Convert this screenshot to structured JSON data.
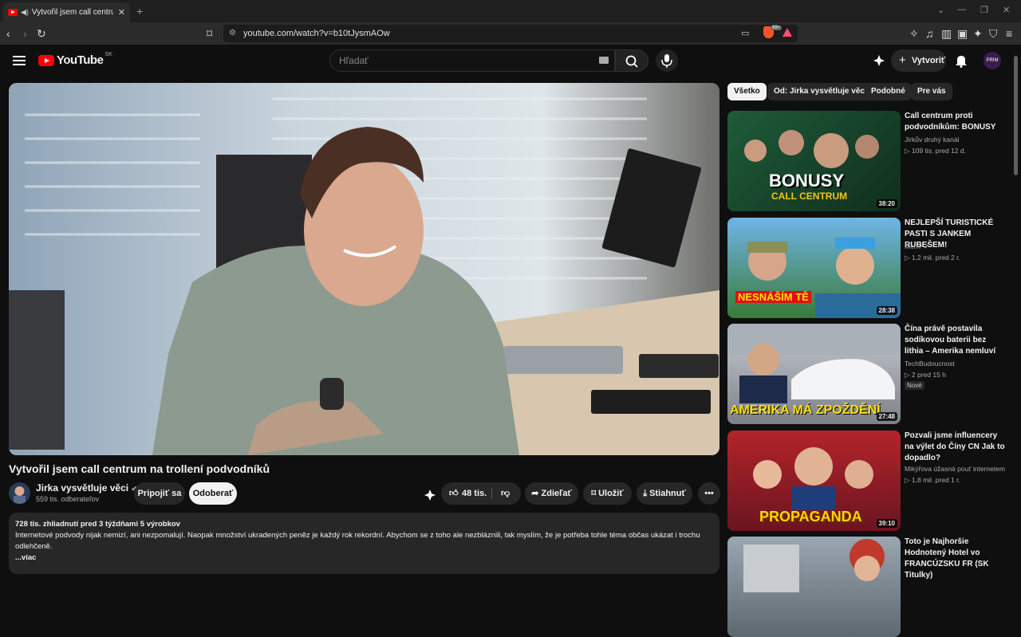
{
  "browser": {
    "tab_title": "Vytvořil jsem call centrum na",
    "url": "youtube.com/watch?v=b10tJysmAOw",
    "shields_badge": "99+"
  },
  "header": {
    "logo_text": "YouTube",
    "logo_region": "SK",
    "search_placeholder": "Hľadať",
    "create_label": "Vytvoriť",
    "avatar_text": "PRIM"
  },
  "video": {
    "title": "Vytvořil jsem call centrum na trollení podvodníků",
    "channel": "Jirka vysvětluje věci",
    "subscribers": "559 tis. odberateľov",
    "join_label": "Pripojiť sa",
    "subscribe_label": "Odoberať",
    "likes": "48 tis.",
    "share_label": "Zdieľať",
    "save_label": "Uložiť",
    "download_label": "Stiahnuť",
    "description": {
      "meta": "728 tis. zhliadnutí  pred 3 týždňami  5 výrobkov",
      "text": "Internetové podvody nijak nemizí, ani nezpomalují. Naopak množství ukradených peněz je každý rok rekordní. Abychom se z toho ale nezbláznili, tak myslím, že je potřeba tohle téma občas ukázat i trochu odlehčeně.",
      "more_label": "...viac"
    }
  },
  "chips": [
    "Všetko",
    "Od: Jirka vysvětluje věci",
    "Podobné",
    "Pre vás"
  ],
  "recommendations": [
    {
      "title": "Call centrum proti podvodníkům: BONUSY",
      "channel": "Jirkův druhý kanál",
      "meta": "▷ 109 tis.   pred 12 d.",
      "duration": "38:20",
      "thumb_text": "BONUSY",
      "thumb_sub": "CALL CENTRUM"
    },
    {
      "title": "NEJLEPŠÍ TURISTICKÉ PASTI S JANKEM RUBEŠEM!",
      "channel": "MenT",
      "meta": "▷ 1,2 mil.   pred 2 r.",
      "duration": "28:38",
      "thumb_text": "NESNÁŠÍM TĚ"
    },
    {
      "title": "Čína právě postavila sodíkovou baterii bez lithia – Amerika nemluví",
      "channel": "TechBudoucnost",
      "meta": "▷ 2   pred 15 h",
      "duration": "27:48",
      "badge": "Nové",
      "thumb_text": "AMERIKA MÁ ZPOŽDĚNÍ"
    },
    {
      "title": "Pozvali jsme influencery na výlet do Číny CN Jak to dopadlo?",
      "channel": "Mikýřova úžasná pouť internetem",
      "meta": "▷ 1,8 mil.   pred 1 r.",
      "duration": "39:10",
      "thumb_text": "PROPAGANDA"
    },
    {
      "title": "Toto je Najhoršie Hodnotený Hotel vo FRANCÚZSKU FR (SK Titulky)",
      "channel": "",
      "meta": "",
      "duration": ""
    }
  ],
  "colors": {
    "background": "#0f0f0f",
    "brand_red": "#ff0000",
    "chip_bg": "#272727"
  }
}
